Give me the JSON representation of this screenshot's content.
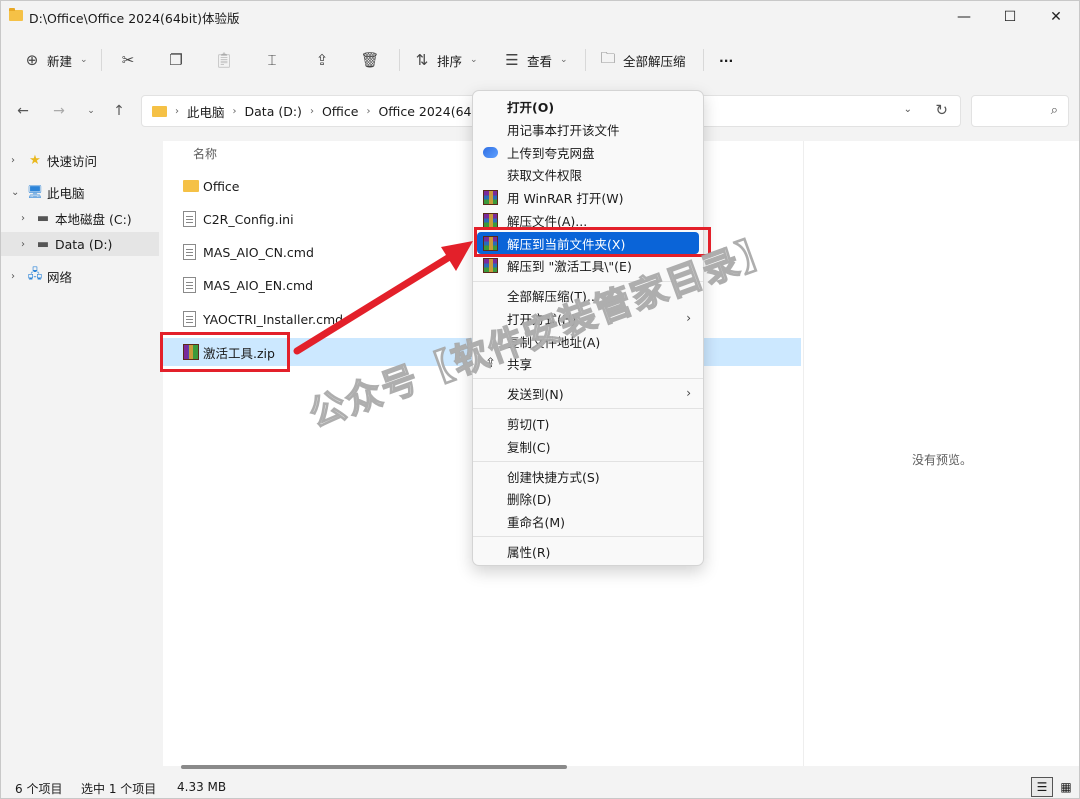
{
  "window": {
    "title": "D:\\Office\\Office 2024(64bit)体验版",
    "controls": {
      "minimize": "—",
      "maximize": "☐",
      "close": "✕"
    }
  },
  "toolbar": {
    "new_label": "新建",
    "sort_label": "排序",
    "view_label": "查看",
    "extract_all_label": "全部解压缩",
    "more_label": "···"
  },
  "address": {
    "crumbs": [
      "此电脑",
      "Data (D:)",
      "Office",
      "Office 2024(64bit"
    ],
    "search_placeholder": ""
  },
  "sidebar": {
    "items": [
      {
        "label": "快速访问",
        "icon": "star-icon"
      },
      {
        "label": "此电脑",
        "icon": "computer-icon"
      },
      {
        "label": "本地磁盘 (C:)",
        "icon": "drive-icon"
      },
      {
        "label": "Data (D:)",
        "icon": "drive-icon"
      },
      {
        "label": "网络",
        "icon": "network-icon"
      }
    ]
  },
  "file_list": {
    "column_name": "名称",
    "files": [
      {
        "name": "Office",
        "type": "folder"
      },
      {
        "name": "C2R_Config.ini",
        "type": "ini"
      },
      {
        "name": "MAS_AIO_CN.cmd",
        "type": "cmd"
      },
      {
        "name": "MAS_AIO_EN.cmd",
        "type": "cmd"
      },
      {
        "name": "YAOCTRI_Installer.cmd",
        "type": "cmd"
      },
      {
        "name": "激活工具.zip",
        "type": "zip",
        "selected": true
      }
    ]
  },
  "preview": {
    "text": "没有预览。"
  },
  "status": {
    "count": "6 个项目",
    "selected": "选中 1 个项目",
    "size": "4.33 MB"
  },
  "context_menu": {
    "items": [
      {
        "label": "打开(O)",
        "bold": true
      },
      {
        "label": "用记事本打开该文件"
      },
      {
        "label": "上传到夸克网盘",
        "icon": "cloud-icon"
      },
      {
        "label": "获取文件权限"
      },
      {
        "label": "用 WinRAR 打开(W)",
        "icon": "winrar-icon"
      },
      {
        "label": "解压文件(A)...",
        "icon": "winrar-icon"
      },
      {
        "label": "解压到当前文件夹(X)",
        "icon": "winrar-icon",
        "highlighted": true
      },
      {
        "label": "解压到 \"激活工具\\\"(E)",
        "icon": "winrar-icon"
      },
      {
        "label": "全部解压缩(T)..."
      },
      {
        "label": "打开方式(H)",
        "submenu": true
      },
      {
        "label": "复制文件地址(A)"
      },
      {
        "label": "共享",
        "icon": "share-icon"
      },
      {
        "label": "发送到(N)",
        "submenu": true
      },
      {
        "label": "剪切(T)"
      },
      {
        "label": "复制(C)"
      },
      {
        "label": "创建快捷方式(S)"
      },
      {
        "label": "删除(D)"
      },
      {
        "label": "重命名(M)"
      },
      {
        "label": "属性(R)"
      }
    ]
  },
  "watermark": "公众号【软件安装管家目录】",
  "colors": {
    "accent": "#0a64d8",
    "annotation_red": "#e3202a",
    "selection": "#cce8ff"
  }
}
